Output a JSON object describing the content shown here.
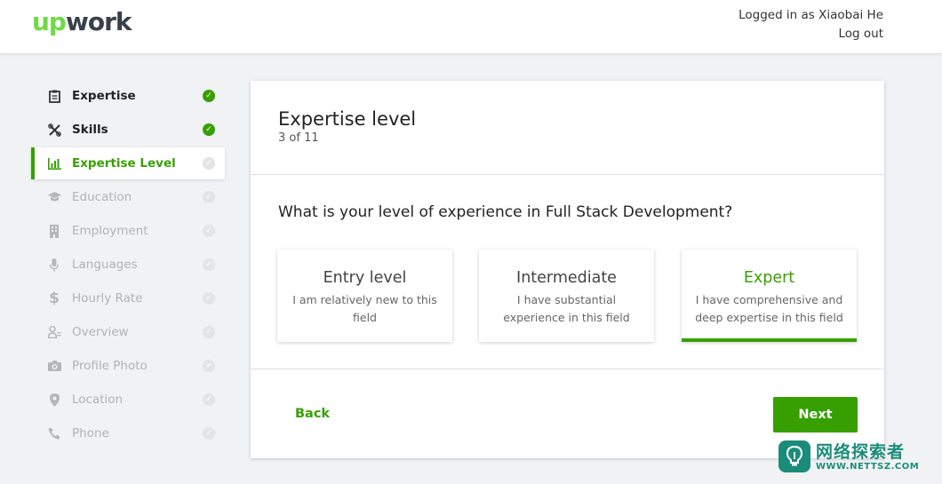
{
  "header": {
    "logo_up": "up",
    "logo_work": "work",
    "logged_in": "Logged in as Xiaobai He",
    "logout": "Log out"
  },
  "sidebar": {
    "items": [
      {
        "label": "Expertise",
        "icon": "clipboard-icon",
        "state": "done"
      },
      {
        "label": "Skills",
        "icon": "tools-icon",
        "state": "done"
      },
      {
        "label": "Expertise Level",
        "icon": "bar-chart-icon",
        "state": "active"
      },
      {
        "label": "Education",
        "icon": "graduation-cap-icon",
        "state": "pending"
      },
      {
        "label": "Employment",
        "icon": "building-icon",
        "state": "pending"
      },
      {
        "label": "Languages",
        "icon": "microphone-icon",
        "state": "pending"
      },
      {
        "label": "Hourly Rate",
        "icon": "dollar-icon",
        "state": "pending"
      },
      {
        "label": "Overview",
        "icon": "user-overview-icon",
        "state": "pending"
      },
      {
        "label": "Profile Photo",
        "icon": "camera-icon",
        "state": "pending"
      },
      {
        "label": "Location",
        "icon": "map-pin-icon",
        "state": "pending"
      },
      {
        "label": "Phone",
        "icon": "phone-icon",
        "state": "pending"
      }
    ]
  },
  "card": {
    "title": "Expertise level",
    "step": "3 of 11",
    "question": "What is your level of experience in Full Stack Development?",
    "options": [
      {
        "title": "Entry level",
        "desc": "I am relatively new to this field",
        "selected": false
      },
      {
        "title": "Intermediate",
        "desc": "I have substantial experience in this field",
        "selected": false
      },
      {
        "title": "Expert",
        "desc": "I have comprehensive and deep expertise in this field",
        "selected": true
      }
    ],
    "back": "Back",
    "next": "Next"
  },
  "watermark": {
    "cn": "网络探索者",
    "url": "WWW.NETTSZ.COM"
  },
  "colors": {
    "brand_green": "#37a000",
    "logo_green": "#6fda44",
    "watermark_teal": "#1c8c7a"
  }
}
